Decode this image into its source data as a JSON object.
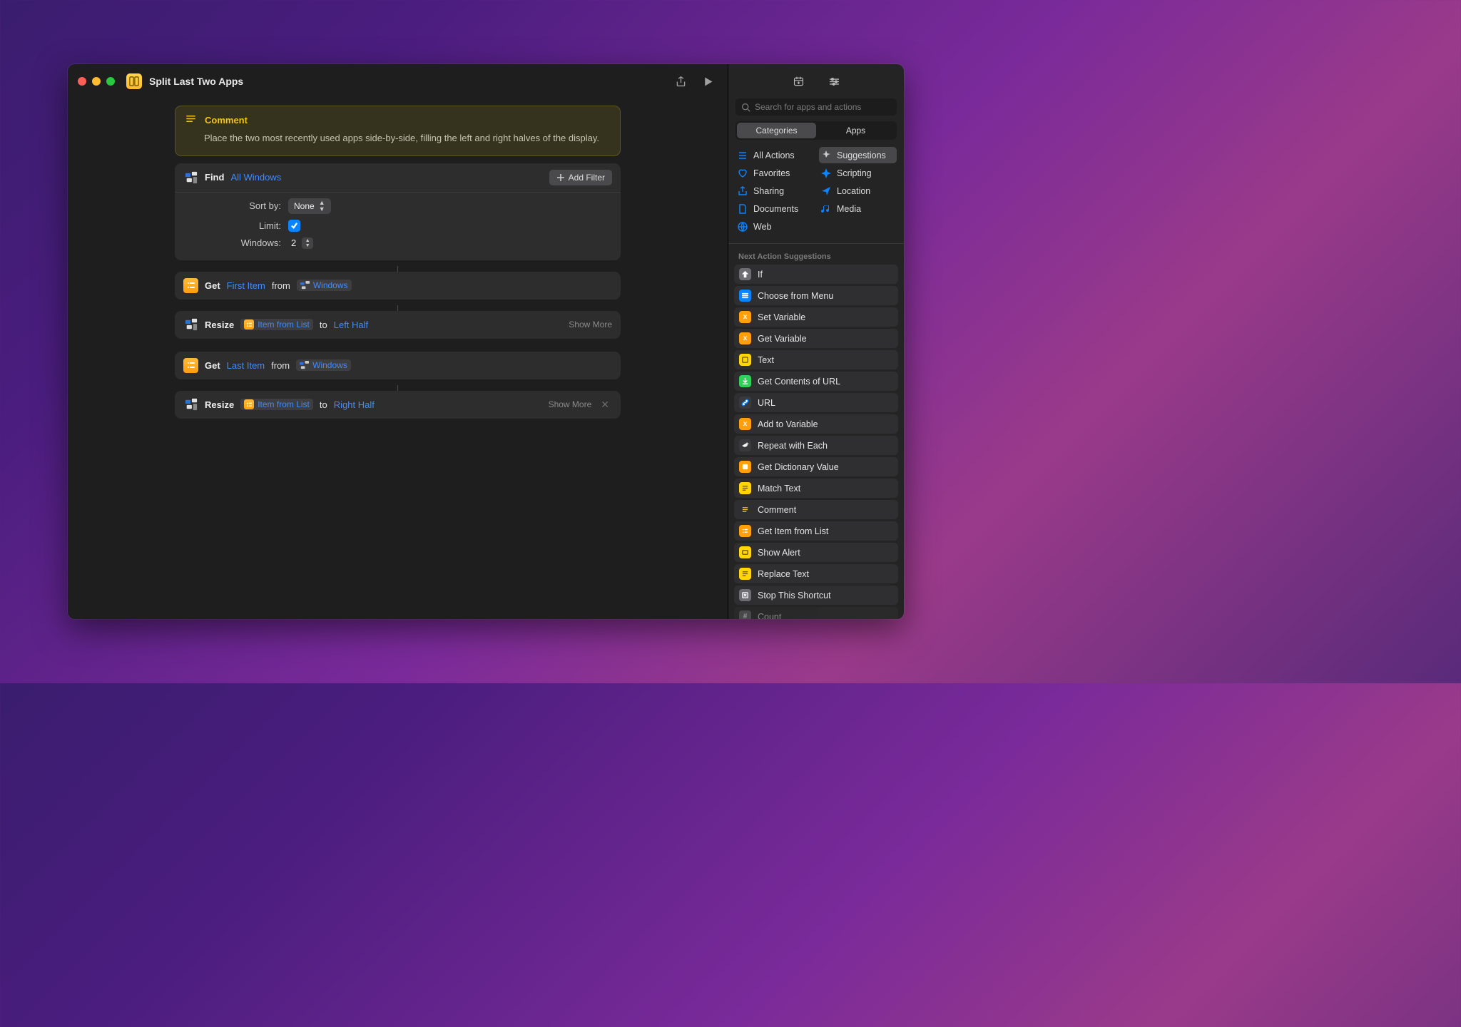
{
  "window": {
    "title": "Split Last Two Apps"
  },
  "comment": {
    "label": "Comment",
    "body": "Place the two most recently used apps side-by-side, filling the left and right halves of the display."
  },
  "find": {
    "kw": "Find",
    "target": "All Windows",
    "add_filter": "Add Filter",
    "sort_label": "Sort by:",
    "sort_value": "None",
    "limit_label": "Limit:",
    "windows_label": "Windows:",
    "windows_value": "2"
  },
  "get1": {
    "kw": "Get",
    "item": "First Item",
    "from": "from",
    "var": "Windows"
  },
  "resize1": {
    "kw": "Resize",
    "var": "Item from List",
    "to": "to",
    "target": "Left Half",
    "show_more": "Show More"
  },
  "get2": {
    "kw": "Get",
    "item": "Last Item",
    "from": "from",
    "var": "Windows"
  },
  "resize2": {
    "kw": "Resize",
    "var": "Item from List",
    "to": "to",
    "target": "Right Half",
    "show_more": "Show More"
  },
  "sidebar": {
    "search_placeholder": "Search for apps and actions",
    "seg": {
      "categories": "Categories",
      "apps": "Apps"
    },
    "cats": {
      "all": "All Actions",
      "suggestions": "Suggestions",
      "favorites": "Favorites",
      "scripting": "Scripting",
      "sharing": "Sharing",
      "location": "Location",
      "documents": "Documents",
      "media": "Media",
      "web": "Web"
    },
    "suggest_head": "Next Action Suggestions",
    "suggestions": [
      "If",
      "Choose from Menu",
      "Set Variable",
      "Get Variable",
      "Text",
      "Get Contents of URL",
      "URL",
      "Add to Variable",
      "Repeat with Each",
      "Get Dictionary Value",
      "Match Text",
      "Comment",
      "Get Item from List",
      "Show Alert",
      "Replace Text",
      "Stop This Shortcut",
      "Count"
    ]
  }
}
